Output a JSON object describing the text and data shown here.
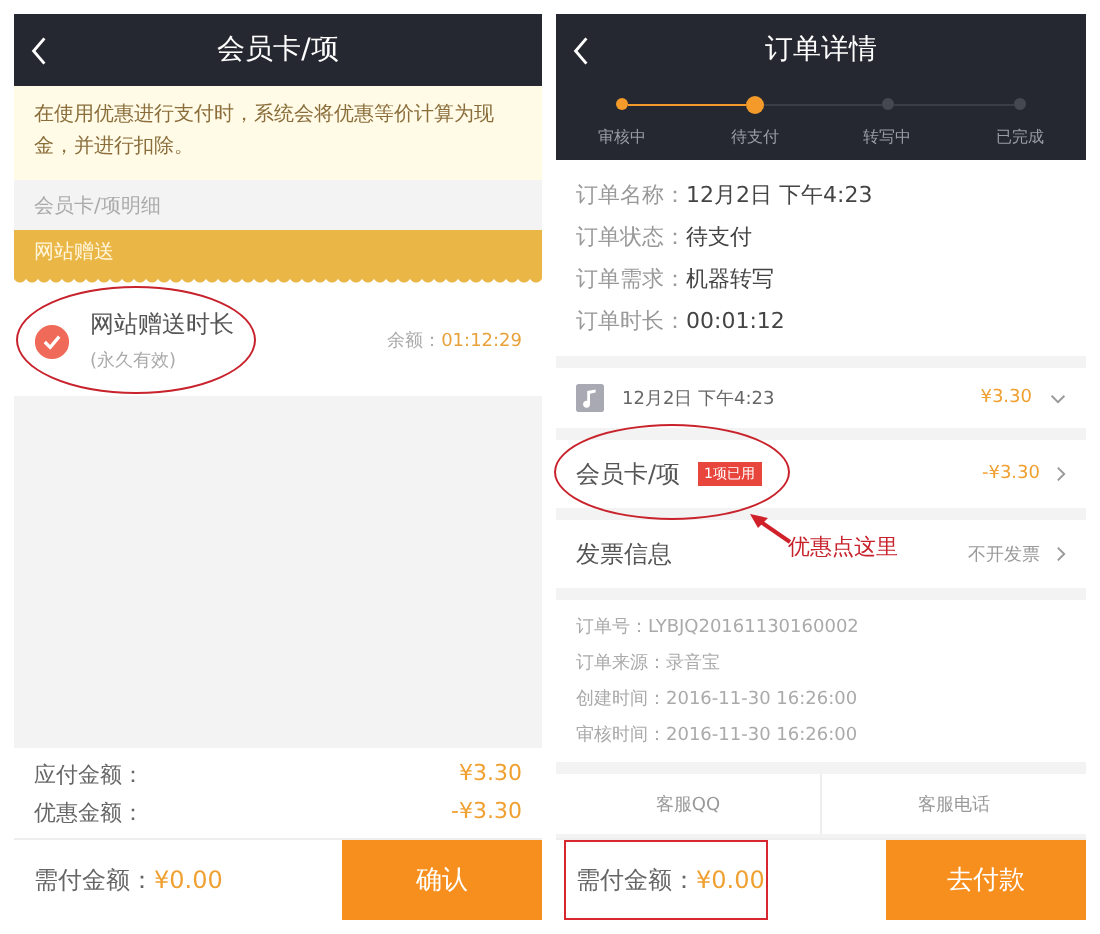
{
  "left_screen": {
    "title": "会员卡/项",
    "notice": "在使用优惠进行支付时，系统会将优惠等价计算为现金，并进行扣除。",
    "section_label": "会员卡/项明细",
    "group_header": "网站赠送",
    "items": [
      {
        "name": "网站赠送时长",
        "note": "(永久有效)",
        "balance_label": "余额：",
        "balance": "01:12:29",
        "checked": true
      }
    ],
    "summary": [
      {
        "label": "应付金额：",
        "value": "¥3.30"
      },
      {
        "label": "优惠金额：",
        "value": "-¥3.30"
      }
    ],
    "due_label": "需付金额：",
    "due_value": "¥0.00",
    "confirm_button": "确认"
  },
  "right_screen": {
    "title": "订单详情",
    "steps": [
      {
        "label": "审核中",
        "done": true,
        "selected": false
      },
      {
        "label": "待支付",
        "done": true,
        "selected": true
      },
      {
        "label": "转写中",
        "done": false,
        "selected": false
      },
      {
        "label": "已完成",
        "done": false,
        "selected": false
      }
    ],
    "info": [
      {
        "label": "订单名称：",
        "value": "12月2日 下午4:23"
      },
      {
        "label": "订单状态：",
        "value": "待支付"
      },
      {
        "label": "订单需求：",
        "value": "机器转写"
      },
      {
        "label": "订单时长：",
        "value": "00:01:12"
      }
    ],
    "audio": {
      "title": "12月2日 下午4:23",
      "price": "¥3.30"
    },
    "coupon": {
      "label": "会员卡/项",
      "badge": "1项已用",
      "value": "-¥3.30"
    },
    "invoice": {
      "label": "发票信息",
      "value": "不开发票"
    },
    "details": [
      "订单号：LYBJQ20161130160002",
      "订单来源：录音宝",
      "创建时间：2016-11-30 16:26:00",
      "审核时间：2016-11-30 16:26:00"
    ],
    "service": [
      "客服QQ",
      "客服电话"
    ],
    "due_label": "需付金额：",
    "due_value": "¥0.00",
    "pay_button": "去付款"
  },
  "annotation": {
    "callout": "优惠点这里"
  }
}
